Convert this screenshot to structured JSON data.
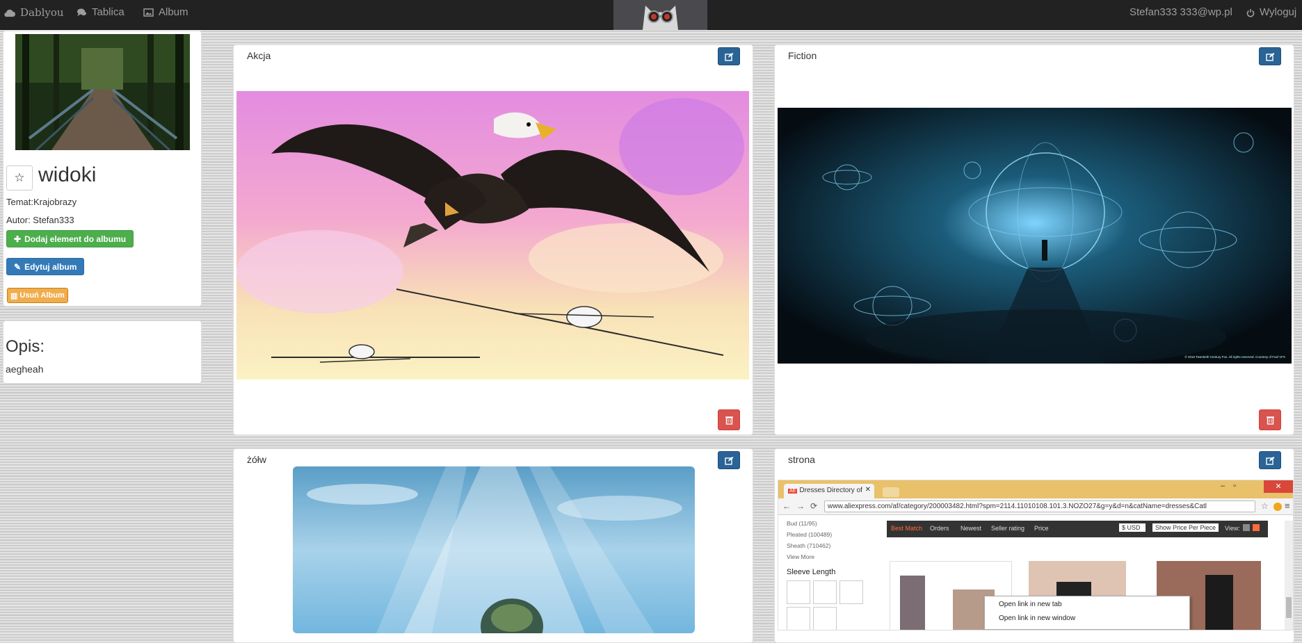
{
  "navbar": {
    "brand": "Dablyou",
    "links": [
      {
        "label": "Tablica",
        "icon": "comments-icon"
      },
      {
        "label": "Album",
        "icon": "picture-icon"
      }
    ],
    "user": "Stefan333 333@wp.pl",
    "logout": "Wyloguj"
  },
  "album": {
    "title": "widoki",
    "topic": "Temat:Krajobrazy",
    "author": "Autor: Stefan333",
    "add_label": "Dodaj element do albumu",
    "edit_label": "Edytuj album",
    "delete_label": "Usuń Album"
  },
  "description": {
    "heading": "Opis:",
    "text": "aegheah"
  },
  "cards": [
    {
      "title": "Akcja"
    },
    {
      "title": "Fiction"
    },
    {
      "title": "żółw"
    },
    {
      "title": "strona"
    }
  ],
  "browser_screenshot": {
    "tab_title": "Dresses Directory of",
    "url": "www.aliexpress.com/af/category/200003482.html?spm=2114.11010108.101.3.NOZO27&g=y&d=n&catName=dresses&Catl",
    "sidebar_items": [
      "Bud (11/95)",
      "Pleated (100489)",
      "Sheath (710462)",
      "View More"
    ],
    "sleeve_label": "Sleeve Length",
    "sort_items": [
      "Best Match",
      "Orders",
      "Newest",
      "Seller rating",
      "Price"
    ],
    "currency": "$ USD",
    "show_price": "Show Price Per Piece",
    "view_label": "View:",
    "context_menu": [
      "Open link in new tab",
      "Open link in new window"
    ]
  },
  "fiction_caption": "© 2015 Twentieth Century Fox. All rights reserved. Courtesy of Fuel VFX"
}
